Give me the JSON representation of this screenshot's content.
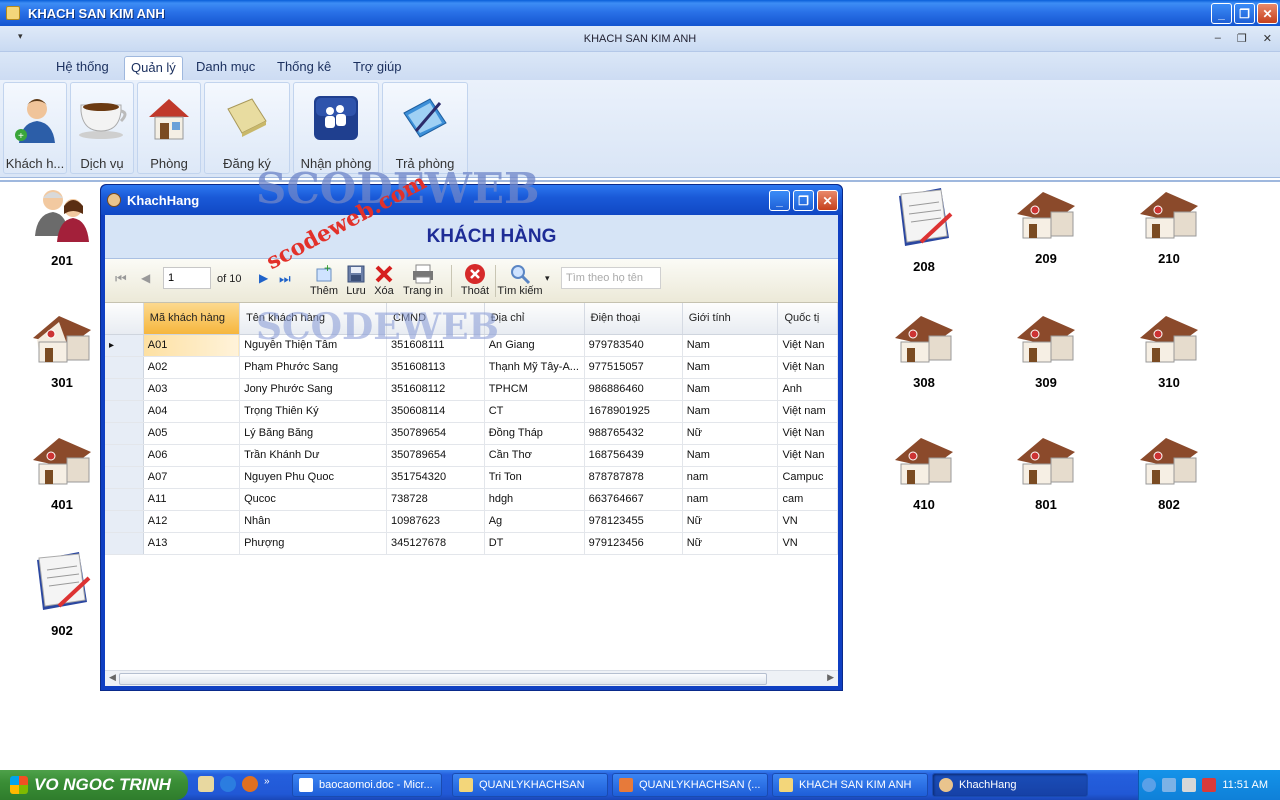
{
  "window": {
    "title": "KHACH SAN KIM ANH",
    "inner_title": "KHACH SAN KIM ANH",
    "minimize": "_",
    "maximize": "❐",
    "close": "✕"
  },
  "menu": {
    "tabs": [
      {
        "label": "Hệ thống"
      },
      {
        "label": "Quản lý"
      },
      {
        "label": "Danh mục"
      },
      {
        "label": "Thống kê"
      },
      {
        "label": "Trợ giúp"
      }
    ]
  },
  "ribbon": {
    "buttons": [
      {
        "label": "Khách h...",
        "icon": "customer-icon"
      },
      {
        "label": "Dịch vụ",
        "icon": "coffee-icon"
      },
      {
        "label": "Phòng",
        "icon": "house-icon"
      },
      {
        "label": "Đăng ký",
        "icon": "book-icon"
      },
      {
        "label": "Nhận phòng",
        "icon": "people-icon"
      },
      {
        "label": "Trả phòng",
        "icon": "pen-book-icon"
      }
    ]
  },
  "rooms_left": [
    {
      "num": "201",
      "icon": "guests-icon"
    },
    {
      "num": "301",
      "icon": "house-icon"
    },
    {
      "num": "401",
      "icon": "house-icon"
    },
    {
      "num": "902",
      "icon": "document-icon"
    }
  ],
  "rooms_right": [
    {
      "num": "208",
      "icon": "document-icon"
    },
    {
      "num": "209",
      "icon": "house-icon"
    },
    {
      "num": "210",
      "icon": "house-icon"
    },
    {
      "num": "308",
      "icon": "house-icon"
    },
    {
      "num": "309",
      "icon": "house-icon"
    },
    {
      "num": "310",
      "icon": "house-icon"
    },
    {
      "num": "410",
      "icon": "house-icon"
    },
    {
      "num": "801",
      "icon": "house-icon"
    },
    {
      "num": "802",
      "icon": "house-icon"
    }
  ],
  "child": {
    "title": "KhachHang",
    "header": "KHÁCH HÀNG",
    "toolbar": {
      "page": "1",
      "of_total": "of 10",
      "add": "Thêm",
      "save": "Lưu",
      "delete": "Xóa",
      "print": "Trang in",
      "exit": "Thoát",
      "search": "Tìm kiếm",
      "search_placeholder": "Tìm theo họ tên"
    },
    "columns": [
      "Mã khách hàng",
      "Tên khách hàng",
      "CMND",
      "Địa chỉ",
      "Điện thoại",
      "Giới tính",
      "Quốc tị"
    ],
    "rows": [
      [
        "A01",
        "Nguyễn Thiện Tâm",
        "351608111",
        "An Giang",
        "979783540",
        "Nam",
        "Việt Nan"
      ],
      [
        "A02",
        "Phạm Phước Sang",
        "351608113",
        "Thạnh Mỹ Tây-A...",
        "977515057",
        "Nam",
        "Việt Nan"
      ],
      [
        "A03",
        "Jony Phước Sang",
        "351608112",
        "TPHCM",
        "986886460",
        "Nam",
        "Anh"
      ],
      [
        "A04",
        "Trọng Thiên Ký",
        "350608114",
        "CT",
        "1678901925",
        "Nam",
        "Việt nam"
      ],
      [
        "A05",
        "Lý Băng Băng",
        "350789654",
        "Đồng Tháp",
        "988765432",
        "Nữ",
        "Việt Nan"
      ],
      [
        "A06",
        "Trần Khánh Dư",
        "350789654",
        "Cần Thơ",
        "168756439",
        "Nam",
        "Việt Nan"
      ],
      [
        "A07",
        "Nguyen Phu Quoc",
        "351754320",
        "Tri Ton",
        "878787878",
        "nam",
        "Campuc"
      ],
      [
        "A11",
        "Qucoc",
        "738728",
        "hdgh",
        "663764667",
        "nam",
        "cam"
      ],
      [
        "A12",
        "Nhân",
        "10987623",
        "Ag",
        "978123455",
        "Nữ",
        "VN"
      ],
      [
        "A13",
        "Phượng",
        "345127678",
        "DT",
        "979123456",
        "Nữ",
        "VN"
      ]
    ]
  },
  "watermark": {
    "text1": "SCODEWEB",
    "text2": "scodeweb.com"
  },
  "taskbar": {
    "start": "VO NGOC TRINH",
    "tasks": [
      "baocaomoi.doc - Micr...",
      "QUANLYKHACHSAN",
      "QUANLYKHACHSAN (...",
      "KHACH SAN KIM ANH",
      "KhachHang"
    ],
    "clock": "11:51 AM"
  }
}
